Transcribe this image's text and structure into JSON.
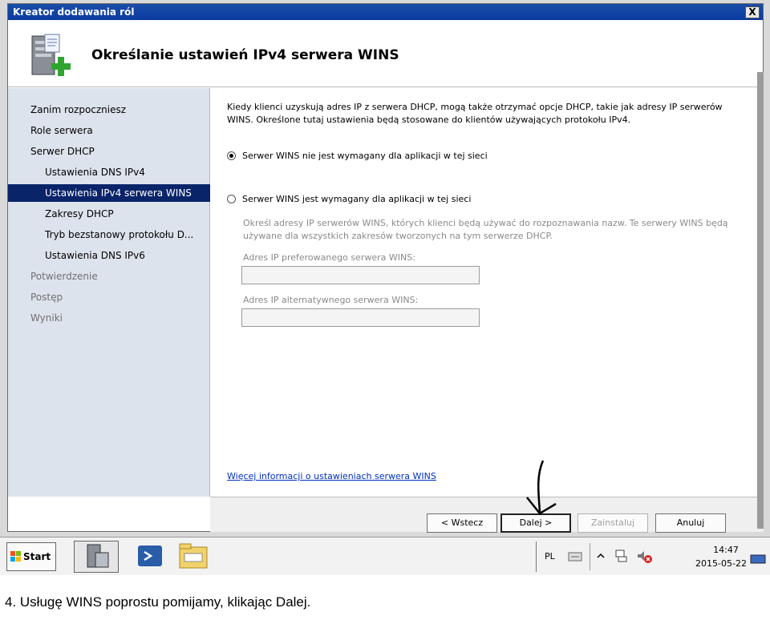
{
  "window": {
    "title": "Kreator dodawania ról",
    "close_glyph": "X"
  },
  "header": {
    "page_title": "Określanie ustawień IPv4 serwera WINS"
  },
  "sidebar": {
    "items": [
      {
        "label": "Zanim rozpoczniesz",
        "level": "top",
        "state": "normal"
      },
      {
        "label": "Role serwera",
        "level": "top",
        "state": "normal"
      },
      {
        "label": "Serwer DHCP",
        "level": "top",
        "state": "normal"
      },
      {
        "label": "Ustawienia DNS IPv4",
        "level": "sub",
        "state": "normal"
      },
      {
        "label": "Ustawienia IPv4 serwera WINS",
        "level": "sub",
        "state": "active"
      },
      {
        "label": "Zakresy DHCP",
        "level": "sub",
        "state": "normal"
      },
      {
        "label": "Tryb bezstanowy protokołu D...",
        "level": "sub",
        "state": "normal"
      },
      {
        "label": "Ustawienia DNS IPv6",
        "level": "sub",
        "state": "normal"
      },
      {
        "label": "Potwierdzenie",
        "level": "top",
        "state": "dim"
      },
      {
        "label": "Postęp",
        "level": "top",
        "state": "dim"
      },
      {
        "label": "Wyniki",
        "level": "top",
        "state": "dim"
      }
    ]
  },
  "content": {
    "intro": "Kiedy klienci uzyskują adres IP z serwera DHCP, mogą także otrzymać opcje DHCP, takie jak adresy IP serwerów WINS. Określone tutaj ustawienia będą stosowane do klientów używających protokołu IPv4.",
    "option_not_required": "Serwer WINS nie jest wymagany dla aplikacji w tej sieci",
    "option_required": "Serwer WINS jest wymagany dla aplikacji w tej sieci",
    "wins_description": "Określ adresy IP serwerów WINS, których klienci będą używać do rozpoznawania nazw. Te serwery WINS będą używane dla wszystkich zakresów tworzonych na tym serwerze DHCP.",
    "preferred_label": "Adres IP preferowanego serwera WINS:",
    "alternate_label": "Adres IP alternatywnego serwera WINS:",
    "preferred_value": "",
    "alternate_value": "",
    "more_info_link": "Więcej informacji o ustawieniach serwera WINS"
  },
  "buttons": {
    "back": "< Wstecz",
    "next": "Dalej >",
    "install": "Zainstaluj",
    "cancel": "Anuluj"
  },
  "taskbar": {
    "start_label": "Start",
    "language": "PL",
    "time": "14:47",
    "date": "2015-05-22"
  },
  "caption": "4. Usługę WINS poprostu pomijamy, klikając Dalej."
}
